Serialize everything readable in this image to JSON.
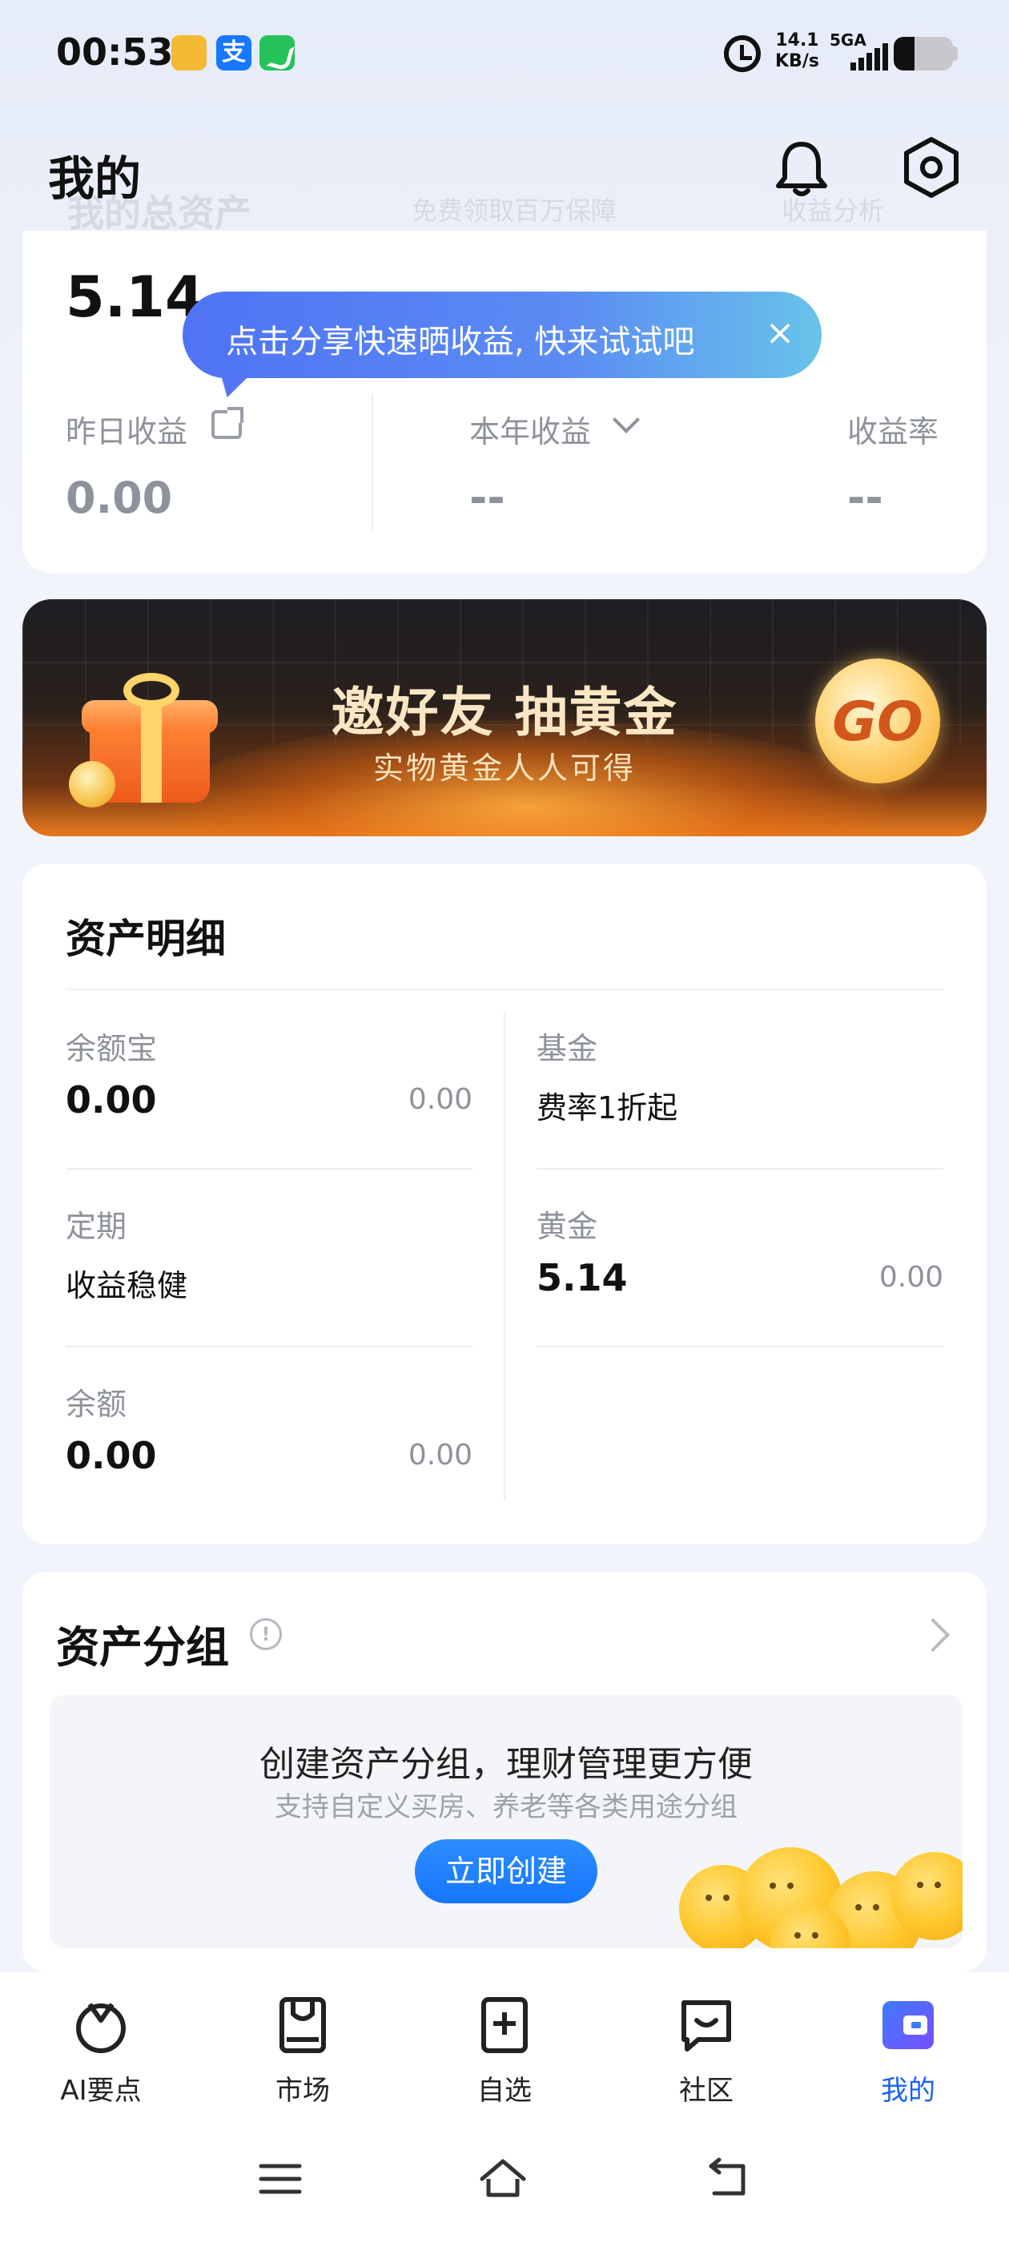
{
  "status_bar": {
    "time": "00:53",
    "alipay_glyph": "支",
    "net_speed_value": "14.1",
    "net_speed_unit": "KB/s",
    "network_type": "5GA",
    "battery_level": 0.35
  },
  "header": {
    "title": "我的",
    "ghost_total_assets": "我的总资产",
    "ghost_insurance": "免费领取百万保障",
    "ghost_analysis": "收益分析"
  },
  "assets": {
    "total": "5.14",
    "tooltip": "点击分享快速晒收益, 快来试试吧",
    "tooltip_close": "×",
    "yesterday_label": "昨日收益",
    "yesterday_value": "0.00",
    "year_label": "本年收益",
    "year_value": "--",
    "rate_label": "收益率",
    "rate_value": "--"
  },
  "banner": {
    "title": "邀好友 抽黄金",
    "subtitle": "实物黄金人人可得",
    "go_label": "GO"
  },
  "asset_detail": {
    "title": "资产明细",
    "items": [
      {
        "label": "余额宝",
        "value": "0.00",
        "side": "0.00"
      },
      {
        "label": "基金",
        "text": "费率1折起"
      },
      {
        "label": "定期",
        "text": "收益稳健"
      },
      {
        "label": "黄金",
        "value": "5.14",
        "side": "0.00"
      },
      {
        "label": "余额",
        "value": "0.00",
        "side": "0.00"
      }
    ]
  },
  "asset_group": {
    "title": "资产分组",
    "info_glyph": "!",
    "headline": "创建资产分组，理财管理更方便",
    "subtitle": "支持自定义买房、养老等各类用途分组",
    "button": "立即创建"
  },
  "bottom_nav": {
    "items": [
      {
        "label": "AI要点",
        "icon": "ai-icon"
      },
      {
        "label": "市场",
        "icon": "market-icon"
      },
      {
        "label": "自选",
        "icon": "watchlist-icon"
      },
      {
        "label": "社区",
        "icon": "community-icon"
      },
      {
        "label": "我的",
        "icon": "wallet-icon"
      }
    ],
    "active_color": "#1a63f0"
  },
  "colors": {
    "accent": "#1677ff",
    "tooltip_start": "#4f73f5",
    "tooltip_end": "#68c3ea",
    "muted_text": "#8e929a"
  }
}
